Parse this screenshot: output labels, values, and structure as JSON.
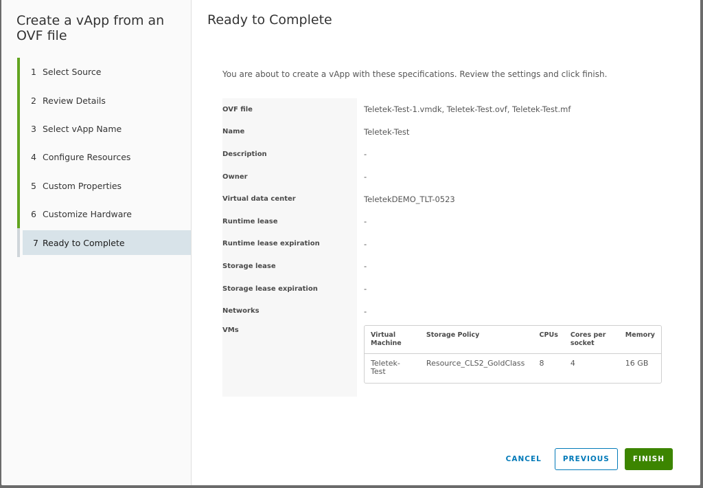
{
  "wizard": {
    "title": "Create a vApp from an OVF file",
    "steps": [
      {
        "num": "1",
        "label": "Select Source"
      },
      {
        "num": "2",
        "label": "Review Details"
      },
      {
        "num": "3",
        "label": "Select vApp Name"
      },
      {
        "num": "4",
        "label": "Configure Resources"
      },
      {
        "num": "5",
        "label": "Custom Properties"
      },
      {
        "num": "6",
        "label": "Customize Hardware"
      },
      {
        "num": "7",
        "label": "Ready to Complete"
      }
    ],
    "active_step": 7
  },
  "page": {
    "title": "Ready to Complete",
    "intro": "You are about to create a vApp with these specifications. Review the settings and click finish."
  },
  "summary": [
    {
      "label": "OVF file",
      "value": "Teletek-Test-1.vmdk, Teletek-Test.ovf, Teletek-Test.mf"
    },
    {
      "label": "Name",
      "value": "Teletek-Test"
    },
    {
      "label": "Description",
      "value": "-"
    },
    {
      "label": "Owner",
      "value": "-"
    },
    {
      "label": "Virtual data center",
      "value": "TeletekDEMO_TLT-0523"
    },
    {
      "label": "Runtime lease",
      "value": "-"
    },
    {
      "label": "Runtime lease expiration",
      "value": "-"
    },
    {
      "label": "Storage lease",
      "value": "-"
    },
    {
      "label": "Storage lease expiration",
      "value": "-"
    },
    {
      "label": "Networks",
      "value": "-"
    },
    {
      "label": "VMs",
      "value": ""
    }
  ],
  "vms": {
    "headers": [
      "Virtual Machine",
      "Storage Policy",
      "CPUs",
      "Cores per socket",
      "Memory"
    ],
    "rows": [
      [
        "Teletek-Test",
        "Resource_CLS2_GoldClass",
        "8",
        "4",
        "16 GB"
      ]
    ]
  },
  "buttons": {
    "cancel": "CANCEL",
    "previous": "PREVIOUS",
    "finish": "FINISH"
  },
  "colors": {
    "accent_green": "#62a420",
    "primary_button": "#3c8500",
    "link_blue": "#0079b8",
    "active_step_bg": "#d8e3e9"
  }
}
